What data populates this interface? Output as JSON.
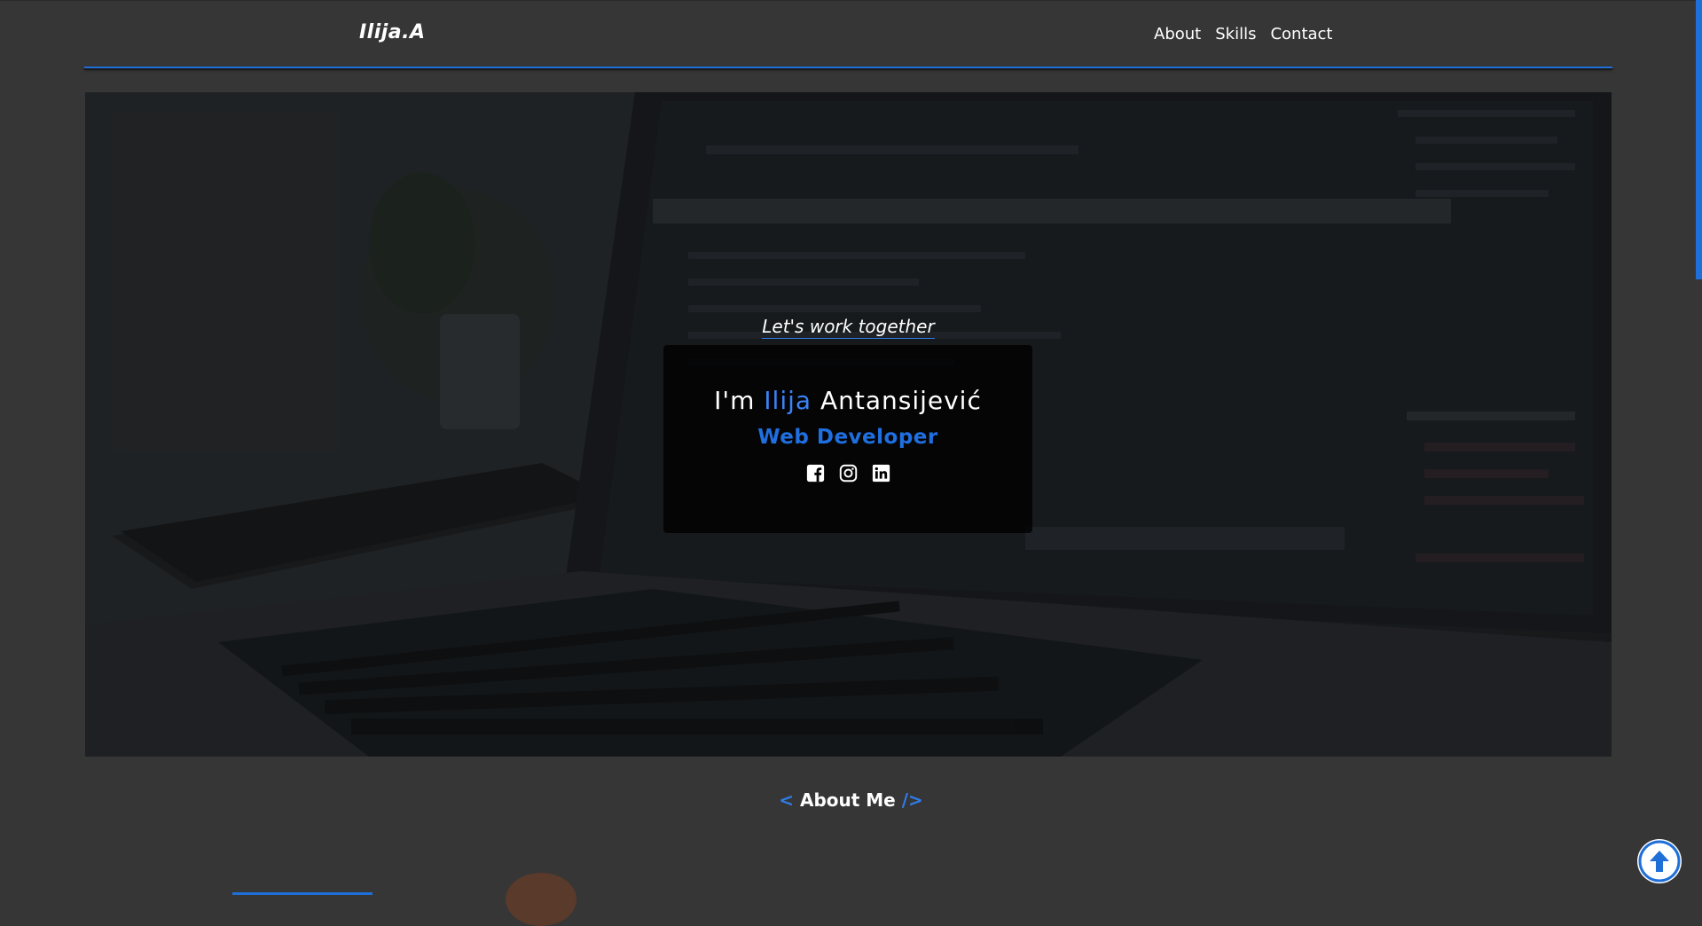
{
  "nav": {
    "brand": "Ilija.A",
    "links": [
      "About",
      "Skills",
      "Contact"
    ]
  },
  "hero": {
    "tagline": "Let's work together",
    "name_prefix": "I'm ",
    "first_name": "Ilija",
    "last_name": " Antansijević",
    "role": "Web Developer",
    "socials": [
      "facebook-icon",
      "instagram-icon",
      "linkedin-icon"
    ]
  },
  "about": {
    "open_bracket": "< ",
    "title": "About Me",
    "close_bracket": " />"
  },
  "colors": {
    "background": "#363636",
    "accent": "#1f6fd8",
    "accent_light": "#3b82f6",
    "text": "#ffffff"
  },
  "icons": {
    "back_to_top": "arrow-up-circle-icon"
  }
}
